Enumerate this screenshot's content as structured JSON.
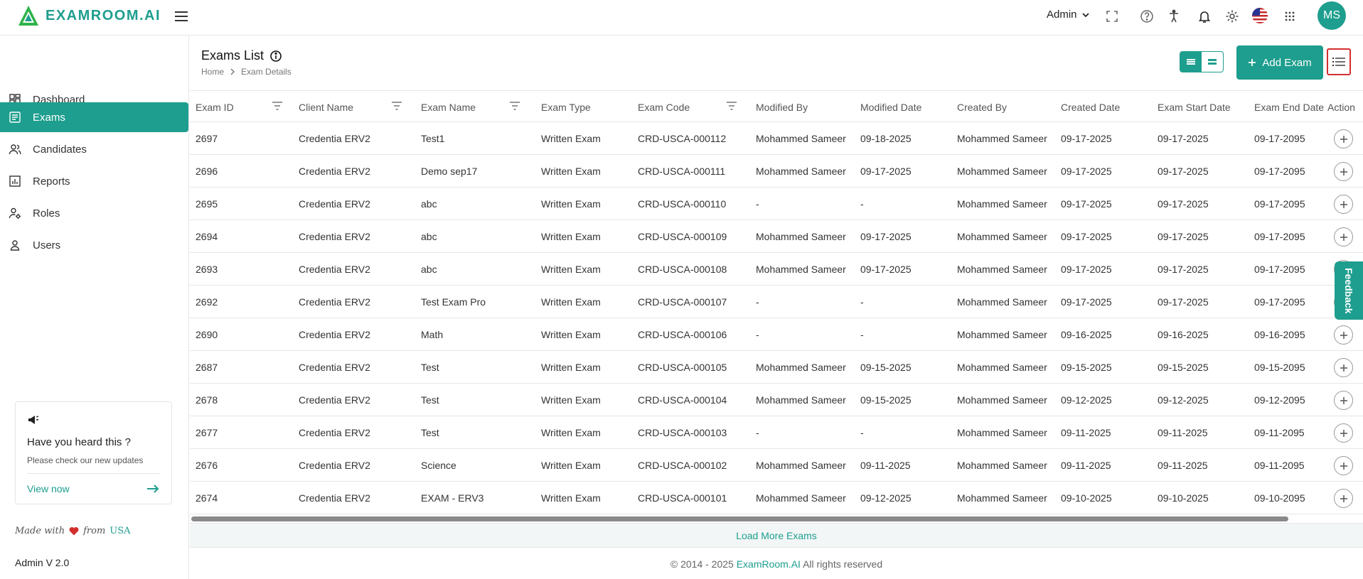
{
  "brand": {
    "logo_text": "EXAMROOM.AI",
    "accent": "#1e9e8e"
  },
  "topbar": {
    "admin_label": "Admin",
    "avatar_initials": "MS",
    "icons": [
      "menu-icon",
      "fullscreen-icon",
      "help-icon",
      "accessibility-icon",
      "bell-icon",
      "gear-icon",
      "us-flag-icon",
      "apps-grid-icon"
    ]
  },
  "sidebar": {
    "items": [
      {
        "label": "Dashboard",
        "icon": "dashboard-icon"
      },
      {
        "label": "Exams",
        "icon": "exams-icon",
        "active": true
      },
      {
        "label": "Candidates",
        "icon": "candidates-icon"
      },
      {
        "label": "Reports",
        "icon": "reports-icon"
      },
      {
        "label": "Roles",
        "icon": "roles-icon"
      },
      {
        "label": "Users",
        "icon": "users-icon"
      }
    ],
    "updates": {
      "title": "Have you heard this ?",
      "subtitle": "Please check our new updates",
      "link": "View now"
    },
    "made_with": "Made with",
    "made_from": "from",
    "made_usa": "USA",
    "version": "Admin V 2.0"
  },
  "page": {
    "title": "Exams List",
    "breadcrumb": [
      "Home",
      "Exam Details"
    ],
    "add_button": "Add Exam",
    "load_more": "Load More Exams",
    "feedback": "Feedback"
  },
  "table": {
    "headers": [
      "Exam ID",
      "Client Name",
      "Exam Name",
      "Exam Type",
      "Exam Code",
      "Modified By",
      "Modified Date",
      "Created By",
      "Created Date",
      "Exam Start Date",
      "Exam End Date",
      "Action"
    ],
    "rows": [
      [
        "2697",
        "Credentia ERV2",
        "Test1",
        "Written Exam",
        "CRD-USCA-000112",
        "Mohammed Sameer",
        "09-18-2025",
        "Mohammed Sameer",
        "09-17-2025",
        "09-17-2025",
        "09-17-2095"
      ],
      [
        "2696",
        "Credentia ERV2",
        "Demo sep17",
        "Written Exam",
        "CRD-USCA-000111",
        "Mohammed Sameer",
        "09-17-2025",
        "Mohammed Sameer",
        "09-17-2025",
        "09-17-2025",
        "09-17-2095"
      ],
      [
        "2695",
        "Credentia ERV2",
        "abc",
        "Written Exam",
        "CRD-USCA-000110",
        "-",
        "-",
        "Mohammed Sameer",
        "09-17-2025",
        "09-17-2025",
        "09-17-2095"
      ],
      [
        "2694",
        "Credentia ERV2",
        "abc",
        "Written Exam",
        "CRD-USCA-000109",
        "Mohammed Sameer",
        "09-17-2025",
        "Mohammed Sameer",
        "09-17-2025",
        "09-17-2025",
        "09-17-2095"
      ],
      [
        "2693",
        "Credentia ERV2",
        "abc",
        "Written Exam",
        "CRD-USCA-000108",
        "Mohammed Sameer",
        "09-17-2025",
        "Mohammed Sameer",
        "09-17-2025",
        "09-17-2025",
        "09-17-2095"
      ],
      [
        "2692",
        "Credentia ERV2",
        "Test Exam Pro",
        "Written Exam",
        "CRD-USCA-000107",
        "-",
        "-",
        "Mohammed Sameer",
        "09-17-2025",
        "09-17-2025",
        "09-17-2095"
      ],
      [
        "2690",
        "Credentia ERV2",
        "Math",
        "Written Exam",
        "CRD-USCA-000106",
        "-",
        "-",
        "Mohammed Sameer",
        "09-16-2025",
        "09-16-2025",
        "09-16-2095"
      ],
      [
        "2687",
        "Credentia ERV2",
        "Test",
        "Written Exam",
        "CRD-USCA-000105",
        "Mohammed Sameer",
        "09-15-2025",
        "Mohammed Sameer",
        "09-15-2025",
        "09-15-2025",
        "09-15-2095"
      ],
      [
        "2678",
        "Credentia ERV2",
        "Test",
        "Written Exam",
        "CRD-USCA-000104",
        "Mohammed Sameer",
        "09-15-2025",
        "Mohammed Sameer",
        "09-12-2025",
        "09-12-2025",
        "09-12-2095"
      ],
      [
        "2677",
        "Credentia ERV2",
        "Test",
        "Written Exam",
        "CRD-USCA-000103",
        "-",
        "-",
        "Mohammed Sameer",
        "09-11-2025",
        "09-11-2025",
        "09-11-2095"
      ],
      [
        "2676",
        "Credentia ERV2",
        "Science",
        "Written Exam",
        "CRD-USCA-000102",
        "Mohammed Sameer",
        "09-11-2025",
        "Mohammed Sameer",
        "09-11-2025",
        "09-11-2025",
        "09-11-2095"
      ],
      [
        "2674",
        "Credentia ERV2",
        "EXAM - ERV3",
        "Written Exam",
        "CRD-USCA-000101",
        "Mohammed Sameer",
        "09-12-2025",
        "Mohammed Sameer",
        "09-10-2025",
        "09-10-2025",
        "09-10-2095"
      ]
    ]
  },
  "footer": {
    "prefix": "© 2014 - 2025",
    "brand": "ExamRoom.AI",
    "suffix": "All rights reserved"
  }
}
